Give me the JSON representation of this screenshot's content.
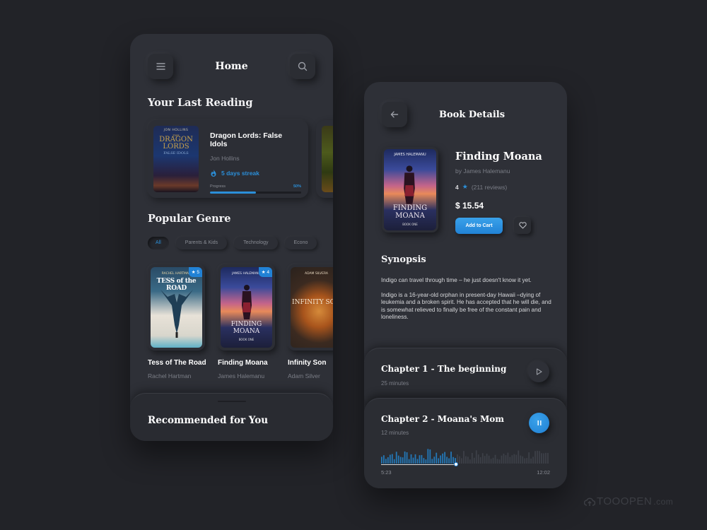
{
  "home": {
    "title": "Home",
    "last_reading_heading": "Your Last Reading",
    "last_reading": {
      "title": "Dragon Lords: False Idols",
      "author": "Jon Hollins",
      "cover_author": "JON HOLLINS",
      "cover_title_line1": "THE",
      "cover_title_line2": "DRAGON",
      "cover_title_line3": "LORDS",
      "cover_subtitle": "FALSE IDOLS",
      "streak": "5 days streak",
      "progress_label": "Progress",
      "progress_text": "50%",
      "progress_value": 0.5
    },
    "popular_genre_heading": "Popular Genre",
    "genres": [
      {
        "label": "All",
        "active": true
      },
      {
        "label": "Parents & Kids",
        "active": false
      },
      {
        "label": "Technology",
        "active": false
      },
      {
        "label": "Econo",
        "active": false
      }
    ],
    "books": [
      {
        "title": "Tess of The Road",
        "author": "Rachel Hartman",
        "rating": "5",
        "cover_author": "RACHEL HARTMAN",
        "cover_title": "TESS of the ROAD"
      },
      {
        "title": "Finding Moana",
        "author": "James Halemanu",
        "rating": "4",
        "cover_author": "JAMES HALEMANU",
        "cover_title": "FINDING MOANA",
        "cover_sub": "BOOK ONE"
      },
      {
        "title": "Infinity Son",
        "author": "Adam Silver",
        "rating": "",
        "cover_author": "ADAM SILVERA",
        "cover_title": "INFINITY SON"
      }
    ],
    "recommended_heading": "Recommended for You"
  },
  "details": {
    "title": "Book Details",
    "book": {
      "title": "Finding Moana",
      "by": "by James Halemanu",
      "rating": "4",
      "reviews": "(211 reviews)",
      "price": "$ 15.54",
      "cover_author": "JAMES HALEMANU",
      "cover_title_line1": "FINDING",
      "cover_title_line2": "MOANA",
      "cover_sub": "BOOK ONE"
    },
    "add_to_cart": "Add to Cart",
    "synopsis_heading": "Synopsis",
    "synopsis": [
      "Indigo can travel through time – he just doesn't know it yet.",
      "Indigo is a 16-year-old orphan in present-day Hawaii –dying of leukemia and a broken spirit. He has accepted that he will die, and is somewhat relieved to finally be free of the constant pain and loneliness."
    ],
    "chapters": [
      {
        "title": "Chapter 1 - The beginning",
        "duration": "25 minutes",
        "state": "paused"
      },
      {
        "title": "Chapter 2 - Moana's Mom",
        "duration": "12 minutes",
        "state": "playing",
        "elapsed": "5:23",
        "total": "12:02",
        "progress": 0.447
      }
    ]
  },
  "colors": {
    "accent": "#2b8fd9",
    "background": "#222328",
    "card": "#2e3037"
  },
  "watermark": {
    "brand": "TOOOPEN",
    "suffix": ".com"
  }
}
